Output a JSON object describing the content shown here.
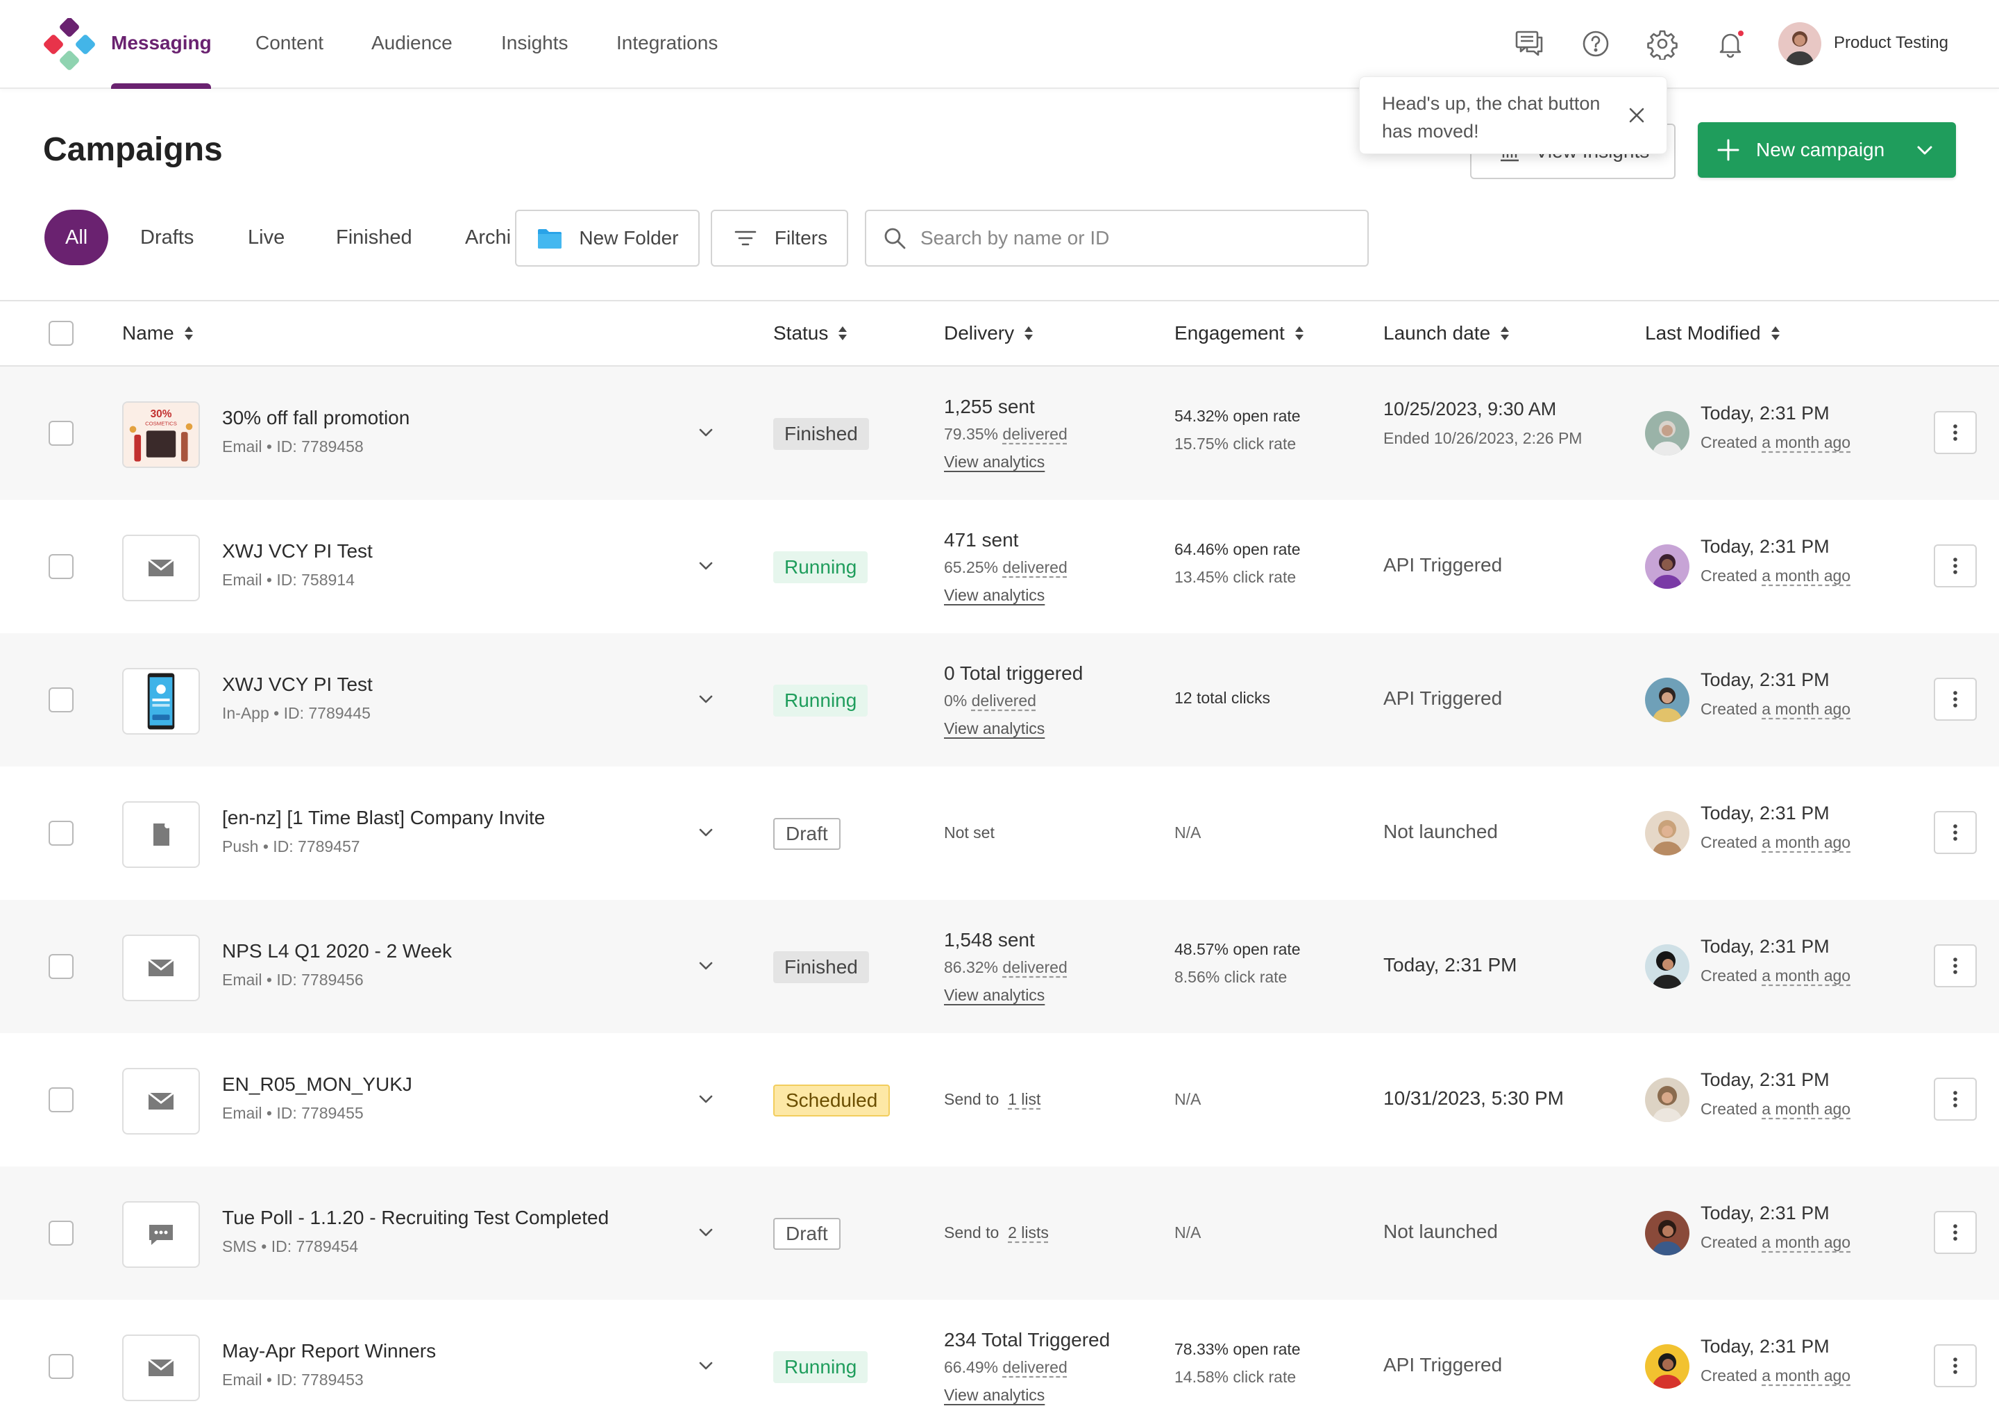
{
  "nav": {
    "items": [
      "Messaging",
      "Content",
      "Audience",
      "Insights",
      "Integrations"
    ],
    "user_name": "Product Testing"
  },
  "tooltip": {
    "text": "Head's up, the chat button has moved!"
  },
  "header": {
    "title": "Campaigns",
    "view_insights_label": "View Insights",
    "new_campaign_label": "New campaign"
  },
  "filters": {
    "tabs": [
      "All",
      "Drafts",
      "Live",
      "Finished",
      "Archi"
    ],
    "new_folder_label": "New Folder",
    "filters_label": "Filters",
    "search_placeholder": "Search by name or ID"
  },
  "table": {
    "headers": [
      "Name",
      "Status",
      "Delivery",
      "Engagement",
      "Launch date",
      "Last Modified"
    ],
    "rows": [
      {
        "name": "30% off fall promotion",
        "channel": "Email",
        "id": "ID: 7789458",
        "status": "Finished",
        "delivery_main": "1,255 sent",
        "delivery_pct": "79.35%",
        "delivery_pct_label": "delivered",
        "delivery_link": "View analytics",
        "engage1": "54.32% open rate",
        "engage2": "15.75% click rate",
        "launch1": "10/25/2023, 9:30 AM",
        "launch2": "Ended 10/26/2023, 2:26 PM",
        "modified": "Today, 2:31 PM",
        "created_prefix": "Created",
        "created_rel": "a month ago"
      },
      {
        "name": "XWJ VCY PI Test",
        "channel": "Email",
        "id": "ID: 758914",
        "status": "Running",
        "delivery_main": "471 sent",
        "delivery_pct": "65.25%",
        "delivery_pct_label": "delivered",
        "delivery_link": "View analytics",
        "engage1": "64.46% open rate",
        "engage2": "13.45% click rate",
        "launch1": "API Triggered",
        "modified": "Today, 2:31 PM",
        "created_prefix": "Created",
        "created_rel": "a month ago"
      },
      {
        "name": "XWJ VCY PI Test",
        "channel": "In-App",
        "id": "ID: 7789445",
        "status": "Running",
        "delivery_main": "0 Total triggered",
        "delivery_pct": "0%",
        "delivery_pct_label": "delivered",
        "delivery_link": "View analytics",
        "engage1": "12 total clicks",
        "launch1": "API Triggered",
        "modified": "Today, 2:31 PM",
        "created_prefix": "Created",
        "created_rel": "a month ago"
      },
      {
        "name": "[en-nz] [1 Time Blast] Company Invite",
        "channel": "Push",
        "id": "ID: 7789457",
        "status": "Draft",
        "delivery_plain": "Not set",
        "engage1": "N/A",
        "launch1": "Not launched",
        "modified": "Today, 2:31 PM",
        "created_prefix": "Created",
        "created_rel": "a month ago"
      },
      {
        "name": "NPS L4 Q1 2020 - 2 Week",
        "channel": "Email",
        "id": "ID: 7789456",
        "status": "Finished",
        "delivery_main": "1,548 sent",
        "delivery_pct": "86.32%",
        "delivery_pct_label": "delivered",
        "delivery_link": "View analytics",
        "engage1": "48.57% open rate",
        "engage2": "8.56% click rate",
        "launch1": "Today, 2:31 PM",
        "modified": "Today, 2:31 PM",
        "created_prefix": "Created",
        "created_rel": "a month ago"
      },
      {
        "name": "EN_R05_MON_YUKJ",
        "channel": "Email",
        "id": "ID: 7789455",
        "status": "Scheduled",
        "send_prefix": "Send to",
        "send_link": "1 list",
        "engage1": "N/A",
        "launch1": "10/31/2023, 5:30 PM",
        "modified": "Today, 2:31 PM",
        "created_prefix": "Created",
        "created_rel": "a month ago"
      },
      {
        "name": "Tue Poll - 1.1.20 - Recruiting Test Completed",
        "channel": "SMS",
        "id": "ID: 7789454",
        "status": "Draft",
        "send_prefix": "Send to",
        "send_link": "2 lists",
        "engage1": "N/A",
        "launch1": "Not launched",
        "modified": "Today, 2:31 PM",
        "created_prefix": "Created",
        "created_rel": "a month ago"
      },
      {
        "name": "May-Apr Report Winners",
        "channel": "Email",
        "id": "ID: 7789453",
        "status": "Running",
        "delivery_main": "234 Total Triggered",
        "delivery_pct": "66.49%",
        "delivery_pct_label": "delivered",
        "delivery_link": "View analytics",
        "engage1": "78.33% open rate",
        "engage2": "14.58% click rate",
        "launch1": "API Triggered",
        "modified": "Today, 2:31 PM",
        "created_prefix": "Created",
        "created_rel": "a month ago"
      }
    ]
  },
  "thumb_promo": {
    "line1": "30%",
    "line2": "COSMETICS"
  },
  "colors": {
    "brand_purple": "#6a2270",
    "primary_green": "#1f9d5c",
    "folder_blue": "#29a3e8"
  }
}
